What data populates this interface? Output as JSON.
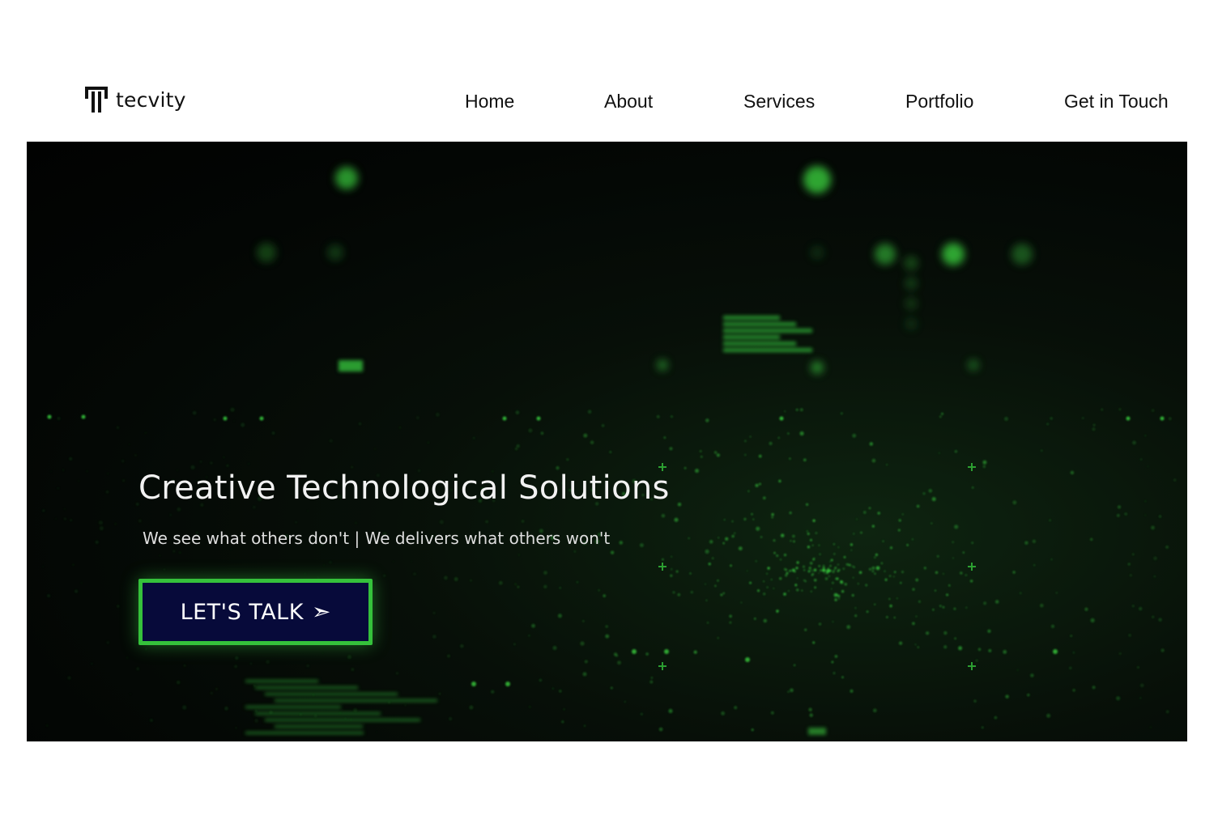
{
  "brand": {
    "name": "tecvity"
  },
  "nav": {
    "items": [
      {
        "label": "Home"
      },
      {
        "label": "About"
      },
      {
        "label": "Services"
      },
      {
        "label": "Portfolio"
      },
      {
        "label": "Get in Touch"
      }
    ]
  },
  "hero": {
    "title": "Creative Technological Solutions",
    "subtitle": "We see what others don't | We delivers what others won't",
    "cta": {
      "label": "LET'S TALK",
      "icon": "send-arrow-icon",
      "arrow_glyph": "➣"
    }
  },
  "colors": {
    "accent_green": "#35c13b",
    "cta_background": "#070a3a",
    "hero_background": "#020403",
    "text_dark": "#111111"
  }
}
